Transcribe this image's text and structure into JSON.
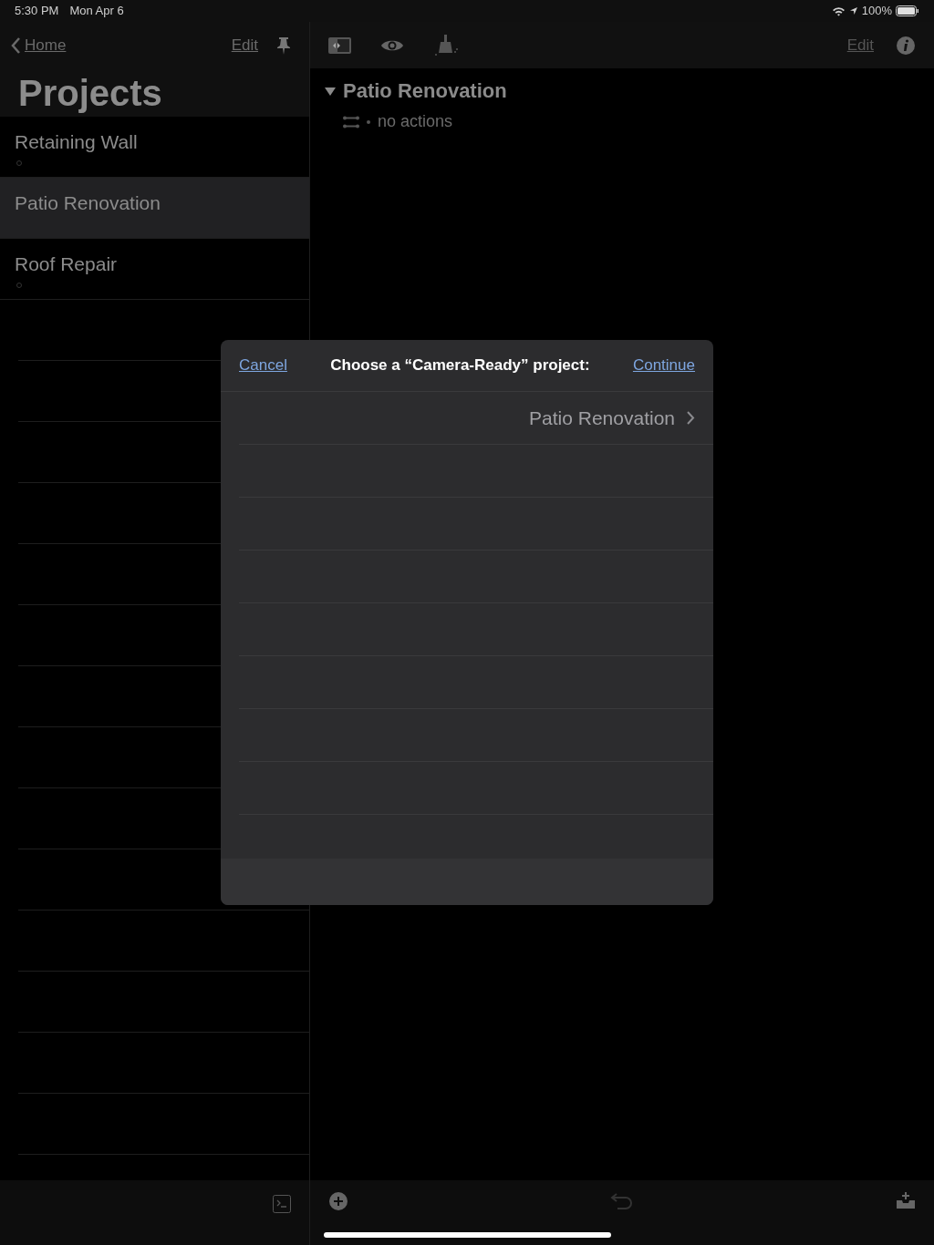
{
  "status_bar": {
    "time": "5:30 PM",
    "date": "Mon Apr 6",
    "battery": "100%"
  },
  "sidebar": {
    "back_label": "Home",
    "edit_label": "Edit",
    "title": "Projects",
    "items": [
      {
        "label": "Retaining Wall",
        "selected": false
      },
      {
        "label": "Patio Renovation",
        "selected": true
      },
      {
        "label": "Roof Repair",
        "selected": false
      }
    ]
  },
  "detail": {
    "edit_label": "Edit",
    "project": {
      "title": "Patio Renovation",
      "expanded": true,
      "summary": "no actions"
    }
  },
  "dialog": {
    "cancel": "Cancel",
    "title": "Choose a “Camera-Ready” project:",
    "continue": "Continue",
    "items": [
      {
        "label": "Patio Renovation"
      }
    ]
  }
}
